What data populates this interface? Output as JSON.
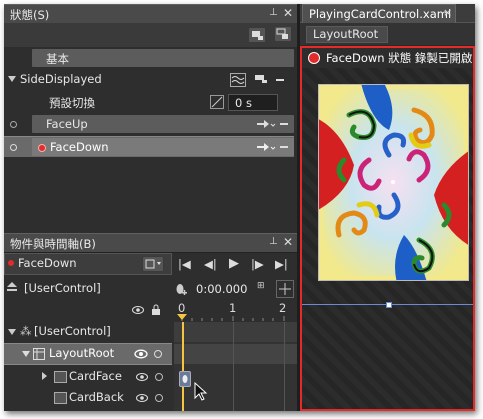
{
  "states_panel": {
    "title": "狀態(S)",
    "base_label": "基本",
    "group_name": "SideDisplayed",
    "default_transition_label": "預設切換",
    "transition_value": "0 s",
    "states": [
      {
        "name": "FaceUp"
      },
      {
        "name": "FaceDown"
      }
    ]
  },
  "objects_panel": {
    "title": "物件與時間軸(B)",
    "storyboard_name": "FaceDown",
    "time_display": "0:00.000",
    "root_scope": "[UserControl]",
    "timeline_ticks": [
      "0",
      "1",
      "2"
    ],
    "tree": [
      {
        "label": "[UserControl]",
        "level": 0
      },
      {
        "label": "LayoutRoot",
        "level": 1
      },
      {
        "label": "CardFace",
        "level": 2
      },
      {
        "label": "CardBack",
        "level": 2
      }
    ]
  },
  "document": {
    "tab_title": "PlayingCardControl.xaml",
    "breadcrumb": "LayoutRoot",
    "recording_banner": "FaceDown 狀態 錄製已開啟"
  },
  "colors": {
    "record_red": "#e32b2b",
    "selection": "#6a6a6a",
    "keyframe_yellow": "#f5c542"
  }
}
